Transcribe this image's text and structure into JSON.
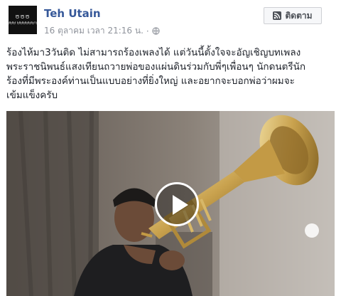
{
  "post": {
    "author": "Teh Utain",
    "avatar_text_top": "ԾԾԾ",
    "avatar_text_bottom": "ᗨᗨᗨ ᗨᗨᗨᗨᗨᗨ ᗨ",
    "date": "16 ตุลาคม เวลา 21:16 น.",
    "separator": "·",
    "privacy_icon": "globe-icon",
    "follow_label": "ติดตาม",
    "follow_icon": "rss-icon",
    "caption_lines": [
      "ร้องไห้มา3วันติด ไม่สามารถร้องเพลงได้ แต่วันนี้ตั้งใจจะอัญเชิญบทเพลง",
      "พระราชนิพนธ์แสงเทียนถวายพ่อของแผ่นดินร่วมกับพี่ๆเพื่อนๆ นักดนตรีนัก",
      "ร้องที่มีพระองค์ท่านเป็นแบบอย่างที่ยิ่งใหญ่ และอยากจะบอกพ่อว่าผมจะ",
      "เข้มแข็งครับ"
    ]
  },
  "video": {
    "play_icon": "play-icon"
  },
  "colors": {
    "link": "#365899",
    "meta": "#90949c",
    "text": "#1d2129",
    "button_bg": "#f6f7f9",
    "button_border": "#ced0d4"
  }
}
